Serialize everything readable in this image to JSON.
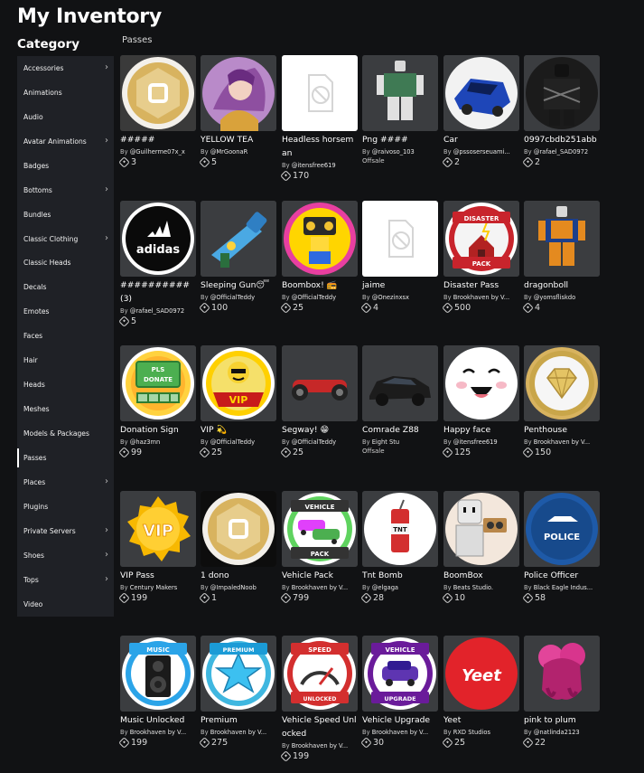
{
  "header": {
    "title": "My Inventory"
  },
  "sidebar": {
    "title": "Category",
    "items": [
      {
        "label": "Accessories",
        "chevron": true
      },
      {
        "label": "Animations",
        "chevron": false
      },
      {
        "label": "Audio",
        "chevron": false
      },
      {
        "label": "Avatar Animations",
        "chevron": true
      },
      {
        "label": "Badges",
        "chevron": false
      },
      {
        "label": "Bottoms",
        "chevron": true
      },
      {
        "label": "Bundles",
        "chevron": false
      },
      {
        "label": "Classic Clothing",
        "chevron": true
      },
      {
        "label": "Classic Heads",
        "chevron": false
      },
      {
        "label": "Decals",
        "chevron": false
      },
      {
        "label": "Emotes",
        "chevron": false
      },
      {
        "label": "Faces",
        "chevron": false
      },
      {
        "label": "Hair",
        "chevron": false
      },
      {
        "label": "Heads",
        "chevron": false
      },
      {
        "label": "Meshes",
        "chevron": false
      },
      {
        "label": "Models & Packages",
        "chevron": false
      },
      {
        "label": "Passes",
        "chevron": false,
        "active": true
      },
      {
        "label": "Places",
        "chevron": true
      },
      {
        "label": "Plugins",
        "chevron": false
      },
      {
        "label": "Private Servers",
        "chevron": true
      },
      {
        "label": "Shoes",
        "chevron": true
      },
      {
        "label": "Tops",
        "chevron": true
      },
      {
        "label": "Video",
        "chevron": false
      }
    ]
  },
  "main": {
    "section_label": "Passes",
    "by_prefix": "By",
    "items": [
      {
        "name": "#####",
        "creator": "@Guilherme07x_x",
        "price": "3",
        "thumb": "robux-gold"
      },
      {
        "name": "YELLOW TEA",
        "creator": "@MrGoonaR",
        "price": "5",
        "thumb": "anime"
      },
      {
        "name": "Headless horseman",
        "creator": "@itensfree619",
        "price": "170",
        "thumb": "placeholder"
      },
      {
        "name": "Png ####",
        "creator": "@raivoso_103",
        "offsale": "Offsale",
        "thumb": "avatar-green"
      },
      {
        "name": "Car",
        "creator": "@pssoserseuami...",
        "price": "2",
        "thumb": "car-blue"
      },
      {
        "name": "0997cbdb251abb",
        "creator": "@rafael_SAD0972",
        "price": "2",
        "thumb": "dark-chains"
      },
      {
        "name": "##########(3)",
        "creator": "@rafael_SAD0972",
        "price": "5",
        "thumb": "adidas"
      },
      {
        "name": "Sleeping Gun😴",
        "creator": "@OfficialTeddy",
        "price": "100",
        "thumb": "gun"
      },
      {
        "name": "Boombox! 📻",
        "creator": "@OfficialTeddy",
        "price": "25",
        "thumb": "boombox-yellow"
      },
      {
        "name": "jaime",
        "creator": "@Onezinxsx",
        "price": "4",
        "thumb": "placeholder"
      },
      {
        "name": "Disaster Pass",
        "creator": "Brookhaven by V...",
        "price": "500",
        "thumb": "disaster"
      },
      {
        "name": "dragonboll",
        "creator": "@yomsfliskdo",
        "price": "4",
        "thumb": "avatar-dragon"
      },
      {
        "name": "Donation Sign",
        "creator": "@haz3mn",
        "price": "99",
        "thumb": "donate"
      },
      {
        "name": "VIP 💫",
        "creator": "@OfficialTeddy",
        "price": "25",
        "thumb": "vip-banner"
      },
      {
        "name": "Segway! 😁",
        "creator": "@OfficialTeddy",
        "price": "25",
        "thumb": "hoverboard"
      },
      {
        "name": "Comrade Z88",
        "creator": "Eight Stu",
        "offsale": "Offsale",
        "thumb": "car-dark"
      },
      {
        "name": "Happy face",
        "creator": "@itensfree619",
        "price": "125",
        "thumb": "happy-face"
      },
      {
        "name": "Penthouse",
        "creator": "Brookhaven by V...",
        "price": "150",
        "thumb": "diamond"
      },
      {
        "name": "VIP Pass",
        "creator": "Century Makers",
        "price": "199",
        "thumb": "vip-badge"
      },
      {
        "name": "1 dono",
        "creator": "@ImpaledNoob",
        "price": "1",
        "thumb": "robux-gold-black"
      },
      {
        "name": "Vehicle Pack",
        "creator": "Brookhaven by V...",
        "price": "799",
        "thumb": "vehicle-pack"
      },
      {
        "name": "Tnt Bomb",
        "creator": "@elgaga",
        "price": "28",
        "thumb": "tnt"
      },
      {
        "name": "BoomBox",
        "creator": "Beats Studio.",
        "price": "10",
        "thumb": "boombox-avatar"
      },
      {
        "name": "Police Officer",
        "creator": "Black Eagle Indus...",
        "price": "58",
        "thumb": "police"
      },
      {
        "name": "Music Unlocked",
        "creator": "Brookhaven by V...",
        "price": "199",
        "thumb": "music"
      },
      {
        "name": "Premium",
        "creator": "Brookhaven by V...",
        "price": "275",
        "thumb": "premium"
      },
      {
        "name": "Vehicle Speed Unlocked",
        "creator": "Brookhaven by V...",
        "price": "199",
        "thumb": "speed"
      },
      {
        "name": "Vehicle Upgrade",
        "creator": "Brookhaven by V...",
        "price": "30",
        "thumb": "upgrade"
      },
      {
        "name": "Yeet",
        "creator": "RXD Studios",
        "price": "25",
        "thumb": "yeet"
      },
      {
        "name": "pink to plum",
        "creator": "@natlinda2123",
        "price": "22",
        "thumb": "pink-hair"
      }
    ],
    "badge_texts": {
      "adidas": "adidas",
      "disaster_top": "DISASTER",
      "disaster_bottom": "PACK",
      "donate_top": "PLS",
      "donate_bottom": "DONATE",
      "vip": "VIP",
      "vehicle_top": "VEHICLE",
      "vehicle_bottom": "PACK",
      "tnt": "TNT",
      "police": "POLICE",
      "music": "MUSIC",
      "premium": "PREMIUM",
      "speed_top": "SPEED",
      "speed_bottom": "UNLOCKED",
      "upgrade_top": "VEHICLE",
      "upgrade_bottom": "UPGRADE",
      "yeet": "Yeet"
    }
  },
  "colors": {
    "background": "#111214",
    "sidebar": "#1f2126",
    "card": "#393b3d",
    "gold": "#d9b45c"
  }
}
